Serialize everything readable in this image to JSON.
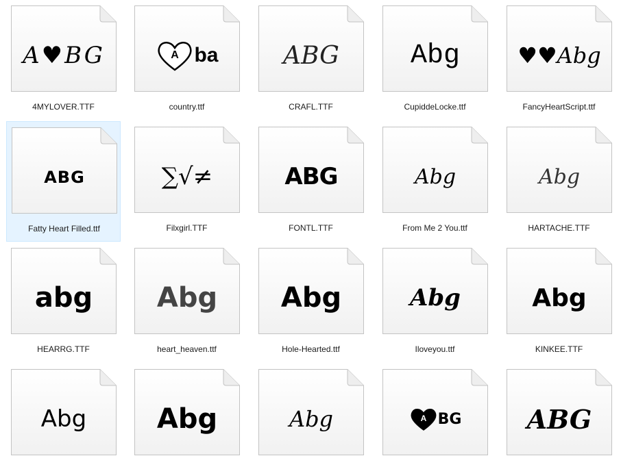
{
  "files": [
    {
      "name": "4MYLOVER.TTF",
      "preview": "A♥BG",
      "style": "p-4mylover"
    },
    {
      "name": "country.ttf",
      "preview": "ba",
      "style": "p-country",
      "heart_letter": "A"
    },
    {
      "name": "CRAFL.TTF",
      "preview": "ABG",
      "style": "p-crafl"
    },
    {
      "name": "CupiddeLocke.ttf",
      "preview": "Abg",
      "style": "p-cupidde"
    },
    {
      "name": "FancyHeartScript.ttf",
      "preview": "♥♥Abg",
      "style": "p-fancy"
    },
    {
      "name": "Fatty Heart Filled.ttf",
      "preview": "ABG",
      "style": "p-fatty"
    },
    {
      "name": "Filxgirl.TTF",
      "preview": "∑√≠",
      "style": "p-filx"
    },
    {
      "name": "FONTL.TTF",
      "preview": "ABG",
      "style": "p-fontl"
    },
    {
      "name": "From Me 2 You.ttf",
      "preview": "Abg",
      "style": "p-fromme"
    },
    {
      "name": "HARTACHE.TTF",
      "preview": "Abg",
      "style": "p-hartache"
    },
    {
      "name": "HEARRG.TTF",
      "preview": "abg",
      "style": "p-hearrg"
    },
    {
      "name": "heart_heaven.ttf",
      "preview": "Abg",
      "style": "p-heaven"
    },
    {
      "name": "Hole-Hearted.ttf",
      "preview": "Abg",
      "style": "p-hole"
    },
    {
      "name": "Iloveyou.ttf",
      "preview": "Abg",
      "style": "p-iloveyou"
    },
    {
      "name": "KINKEE.TTF",
      "preview": "Abg",
      "style": "p-kinkee"
    },
    {
      "name": "",
      "preview": "Abg",
      "style": "p-r4a"
    },
    {
      "name": "",
      "preview": "Abg",
      "style": "p-r4b"
    },
    {
      "name": "",
      "preview": "Abg",
      "style": "p-r4c"
    },
    {
      "name": "",
      "preview": "BG",
      "style": "p-r4d",
      "heart_letter": "A"
    },
    {
      "name": "",
      "preview": "ABG",
      "style": "p-r4e"
    }
  ],
  "selected_index": 5,
  "colors": {
    "selection_bg": "#e5f3ff",
    "selection_border": "#cce8ff",
    "doc_fill": "#ffffff",
    "doc_edge": "#c8c8c8"
  },
  "icons": {
    "file_thumbnail": "document-page-icon",
    "fold": "page-corner-fold-icon"
  }
}
